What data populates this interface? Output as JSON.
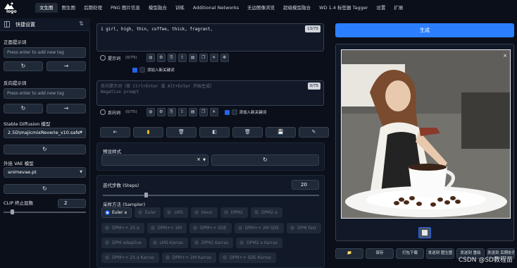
{
  "logo": {
    "text": "logo"
  },
  "tabs": [
    "文生图",
    "图生图",
    "后期处理",
    "PNG 图片信息",
    "模型融合",
    "训练",
    "Additional Networks",
    "无边图像浏览",
    "超级模型融合",
    "WD 1.4 标签器 Tagger",
    "设置",
    "扩展"
  ],
  "sidebar": {
    "title": "快捷设置",
    "positive_label": "正面提示词",
    "positive_placeholder": "Press enter to add new tag",
    "negative_label": "反向提示词",
    "negative_placeholder": "Press enter to add new tag",
    "model_label": "Stable Diffusion 模型",
    "model_value": "2.5D\\majicmixReverie_v10.safe",
    "vae_label": "外挂 VAE 模型",
    "vae_value": "animevae.pt",
    "clip_label": "CLIP 终止层数",
    "clip_value": "2",
    "clip_level": 0.1
  },
  "prompt": {
    "text": "1 girl, high, thin, coffee, thick, fragrant,",
    "token": "13/75",
    "label": "提示词",
    "count": "(0/75)",
    "add_tag_label": "添加入新关键词"
  },
  "negative": {
    "placeholder_line1": "反向提示词（按 Ctrl+Enter 或 Alt+Enter 开始生成）",
    "placeholder_line2": "Negative prompt",
    "token": "0/75",
    "label": "反向词",
    "count": "(0/75)",
    "add_tag_label": "添加入新关键词"
  },
  "icons": {
    "refresh": "↻",
    "arrow": "→",
    "swap": "⇆",
    "trash": "🗑",
    "save": "💾",
    "close": "×",
    "caret": "▼"
  },
  "action_buttons": [
    "⇤",
    "▮",
    "🗑",
    "◧",
    "🗑",
    "💾",
    "✎"
  ],
  "styles_label": "预设样式",
  "steps": {
    "label": "迭代步数 (Steps)",
    "value": "20",
    "level": 0.2
  },
  "sampler": {
    "label": "采样方法 (Sampler)",
    "rows": [
      [
        "Euler a",
        "Euler",
        "LMS",
        "Heun",
        "DPM2",
        "DPM2 a"
      ],
      [
        "DPM++ 2S a",
        "DPM++ 2M",
        "DPM++ SDE",
        "DPM++ 2M SDE",
        "DPM fast"
      ],
      [
        "DPM adaptive",
        "LMS Karras",
        "DPM2 Karras",
        "DPM2 a Karras"
      ],
      [
        "DPM++ 2S a Karras",
        "DPM++ 2M Karras",
        "DPM++ SDE Karras"
      ]
    ],
    "selected": "Euler a"
  },
  "generate_label": "生成",
  "output_buttons": [
    "📁",
    "保存",
    "打包下载",
    "发送到 图生图",
    "发送到 重绘",
    "发送到 后期处理"
  ],
  "watermark": "CSDN @SD教程苗"
}
